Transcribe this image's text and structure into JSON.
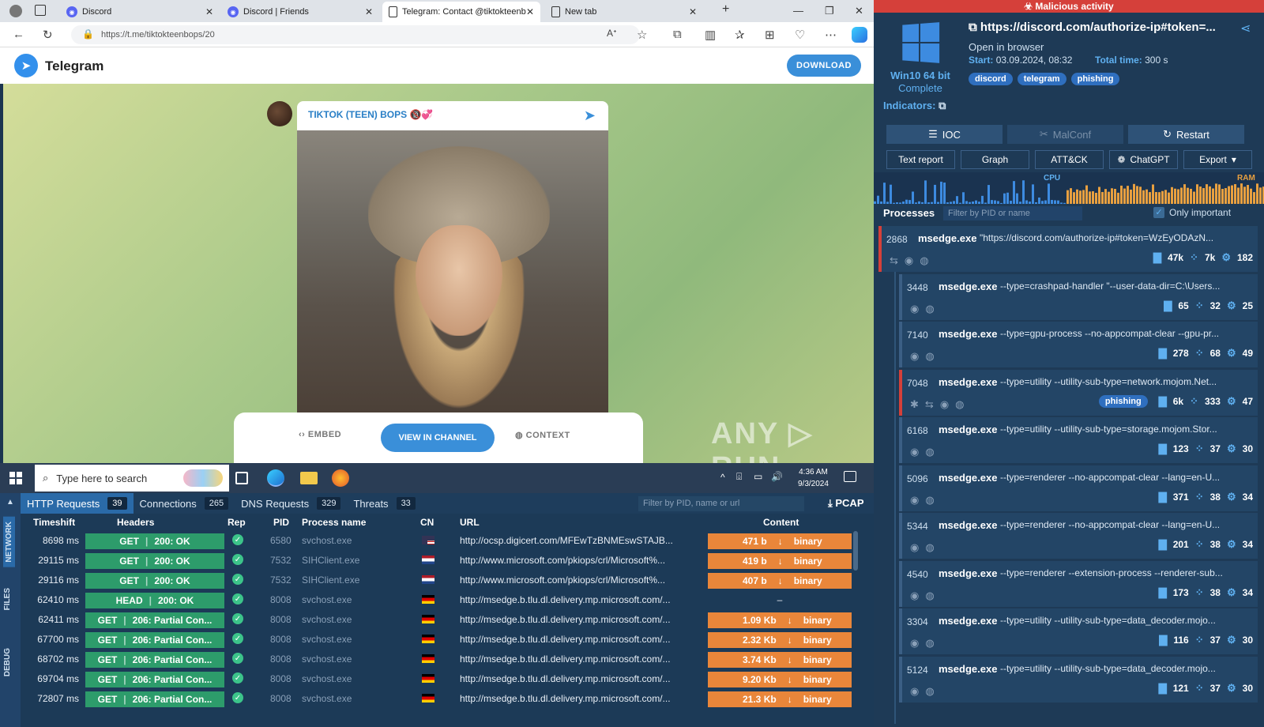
{
  "browser": {
    "tabs": [
      {
        "label": "Discord"
      },
      {
        "label": "Discord | Friends"
      },
      {
        "label": "Telegram: Contact @tiktokteenb"
      },
      {
        "label": "New tab"
      }
    ],
    "url": "https://t.me/tiktokteenbops/20"
  },
  "telegram": {
    "brand": "Telegram",
    "download": "DOWNLOAD",
    "channel": "TIKTOK (TEEN) BOPS 🔞💞",
    "embed": "EMBED",
    "view_in_channel": "VIEW IN CHANNEL",
    "context": "CONTEXT"
  },
  "watermark": "ANY ▷ RUN",
  "taskbar": {
    "search_placeholder": "Type here to search",
    "time": "4:36 AM",
    "date": "9/3/2024"
  },
  "network": {
    "side_labels": [
      "NETWORK",
      "FILES",
      "DEBUG"
    ],
    "tabs": [
      {
        "label": "HTTP Requests",
        "count": "39"
      },
      {
        "label": "Connections",
        "count": "265"
      },
      {
        "label": "DNS Requests",
        "count": "329"
      },
      {
        "label": "Threats",
        "count": "33"
      }
    ],
    "filter_placeholder": "Filter by PID, name or url",
    "pcap": "PCAP",
    "columns": [
      "Timeshift",
      "Headers",
      "Rep",
      "PID",
      "Process name",
      "CN",
      "URL",
      "Content"
    ],
    "rows": [
      {
        "ts": "8698 ms",
        "method": "GET",
        "status": "200: OK",
        "pid": "6580",
        "proc": "svchost.exe",
        "cn": "us",
        "url": "http://ocsp.digicert.com/MFEwTzBNMEswSTAJB...",
        "size": "471 b",
        "type": "binary"
      },
      {
        "ts": "29115 ms",
        "method": "GET",
        "status": "200: OK",
        "pid": "7532",
        "proc": "SIHClient.exe",
        "cn": "nl",
        "url": "http://www.microsoft.com/pkiops/crl/Microsoft%...",
        "size": "419 b",
        "type": "binary"
      },
      {
        "ts": "29116 ms",
        "method": "GET",
        "status": "200: OK",
        "pid": "7532",
        "proc": "SIHClient.exe",
        "cn": "nl",
        "url": "http://www.microsoft.com/pkiops/crl/Microsoft%...",
        "size": "407 b",
        "type": "binary"
      },
      {
        "ts": "62410 ms",
        "method": "HEAD",
        "status": "200: OK",
        "pid": "8008",
        "proc": "svchost.exe",
        "cn": "de",
        "url": "http://msedge.b.tlu.dl.delivery.mp.microsoft.com/...",
        "size": "",
        "type": "",
        "dash": "–"
      },
      {
        "ts": "62411 ms",
        "method": "GET",
        "status": "206: Partial Con...",
        "pid": "8008",
        "proc": "svchost.exe",
        "cn": "de",
        "url": "http://msedge.b.tlu.dl.delivery.mp.microsoft.com/...",
        "size": "1.09 Kb",
        "type": "binary"
      },
      {
        "ts": "67700 ms",
        "method": "GET",
        "status": "206: Partial Con...",
        "pid": "8008",
        "proc": "svchost.exe",
        "cn": "de",
        "url": "http://msedge.b.tlu.dl.delivery.mp.microsoft.com/...",
        "size": "2.32 Kb",
        "type": "binary"
      },
      {
        "ts": "68702 ms",
        "method": "GET",
        "status": "206: Partial Con...",
        "pid": "8008",
        "proc": "svchost.exe",
        "cn": "de",
        "url": "http://msedge.b.tlu.dl.delivery.mp.microsoft.com/...",
        "size": "3.74 Kb",
        "type": "binary"
      },
      {
        "ts": "69704 ms",
        "method": "GET",
        "status": "206: Partial Con...",
        "pid": "8008",
        "proc": "svchost.exe",
        "cn": "de",
        "url": "http://msedge.b.tlu.dl.delivery.mp.microsoft.com/...",
        "size": "9.20 Kb",
        "type": "binary"
      },
      {
        "ts": "72807 ms",
        "method": "GET",
        "status": "206: Partial Con...",
        "pid": "8008",
        "proc": "svchost.exe",
        "cn": "de",
        "url": "http://msedge.b.tlu.dl.delivery.mp.microsoft.com/...",
        "size": "21.3 Kb",
        "type": "binary"
      }
    ]
  },
  "analysis": {
    "verdict": "Malicious activity",
    "os": "Win10 64 bit",
    "status": "Complete",
    "url": "https://discord.com/authorize-ip#token=...",
    "open_in": "Open in browser",
    "start_label": "Start:",
    "start": "03.09.2024, 08:32",
    "total_label": "Total time:",
    "total": "300 s",
    "tags": [
      "discord",
      "telegram",
      "phishing"
    ],
    "indicators": "Indicators:",
    "buttons_top": [
      "IOC",
      "MalConf",
      "Restart"
    ],
    "buttons_bottom": [
      "Text report",
      "Graph",
      "ATT&CK",
      "ChatGPT",
      "Export"
    ],
    "cpu_label": "CPU",
    "ram_label": "RAM",
    "processes_label": "Processes",
    "filter_placeholder": "Filter by PID or name",
    "only_important": "Only important"
  },
  "processes": [
    {
      "pid": "2868",
      "name": "msedge.exe",
      "cmd": "\"https://discord.com/authorize-ip#token=WzEyODAzN...",
      "files": "47k",
      "reg": "7k",
      "net": "182",
      "tag": ""
    },
    {
      "pid": "3448",
      "name": "msedge.exe",
      "cmd": "--type=crashpad-handler \"--user-data-dir=C:\\Users...",
      "files": "65",
      "reg": "32",
      "net": "25",
      "tag": ""
    },
    {
      "pid": "7140",
      "name": "msedge.exe",
      "cmd": "--type=gpu-process --no-appcompat-clear --gpu-pr...",
      "files": "278",
      "reg": "68",
      "net": "49",
      "tag": ""
    },
    {
      "pid": "7048",
      "name": "msedge.exe",
      "cmd": "--type=utility --utility-sub-type=network.mojom.Net...",
      "files": "6k",
      "reg": "333",
      "net": "47",
      "tag": "phishing"
    },
    {
      "pid": "6168",
      "name": "msedge.exe",
      "cmd": "--type=utility --utility-sub-type=storage.mojom.Stor...",
      "files": "123",
      "reg": "37",
      "net": "30",
      "tag": ""
    },
    {
      "pid": "5096",
      "name": "msedge.exe",
      "cmd": "--type=renderer --no-appcompat-clear --lang=en-U...",
      "files": "371",
      "reg": "38",
      "net": "34",
      "tag": ""
    },
    {
      "pid": "5344",
      "name": "msedge.exe",
      "cmd": "--type=renderer --no-appcompat-clear --lang=en-U...",
      "files": "201",
      "reg": "38",
      "net": "34",
      "tag": ""
    },
    {
      "pid": "4540",
      "name": "msedge.exe",
      "cmd": "--type=renderer --extension-process --renderer-sub...",
      "files": "173",
      "reg": "38",
      "net": "34",
      "tag": ""
    },
    {
      "pid": "3304",
      "name": "msedge.exe",
      "cmd": "--type=utility --utility-sub-type=data_decoder.mojo...",
      "files": "116",
      "reg": "37",
      "net": "30",
      "tag": ""
    },
    {
      "pid": "5124",
      "name": "msedge.exe",
      "cmd": "--type=utility --utility-sub-type=data_decoder.mojo...",
      "files": "121",
      "reg": "37",
      "net": "30",
      "tag": ""
    }
  ],
  "colors": {
    "malicious": "#d5403a",
    "accent": "#3a8fd9",
    "ok": "#2d9c6b",
    "content": "#e9863a"
  }
}
